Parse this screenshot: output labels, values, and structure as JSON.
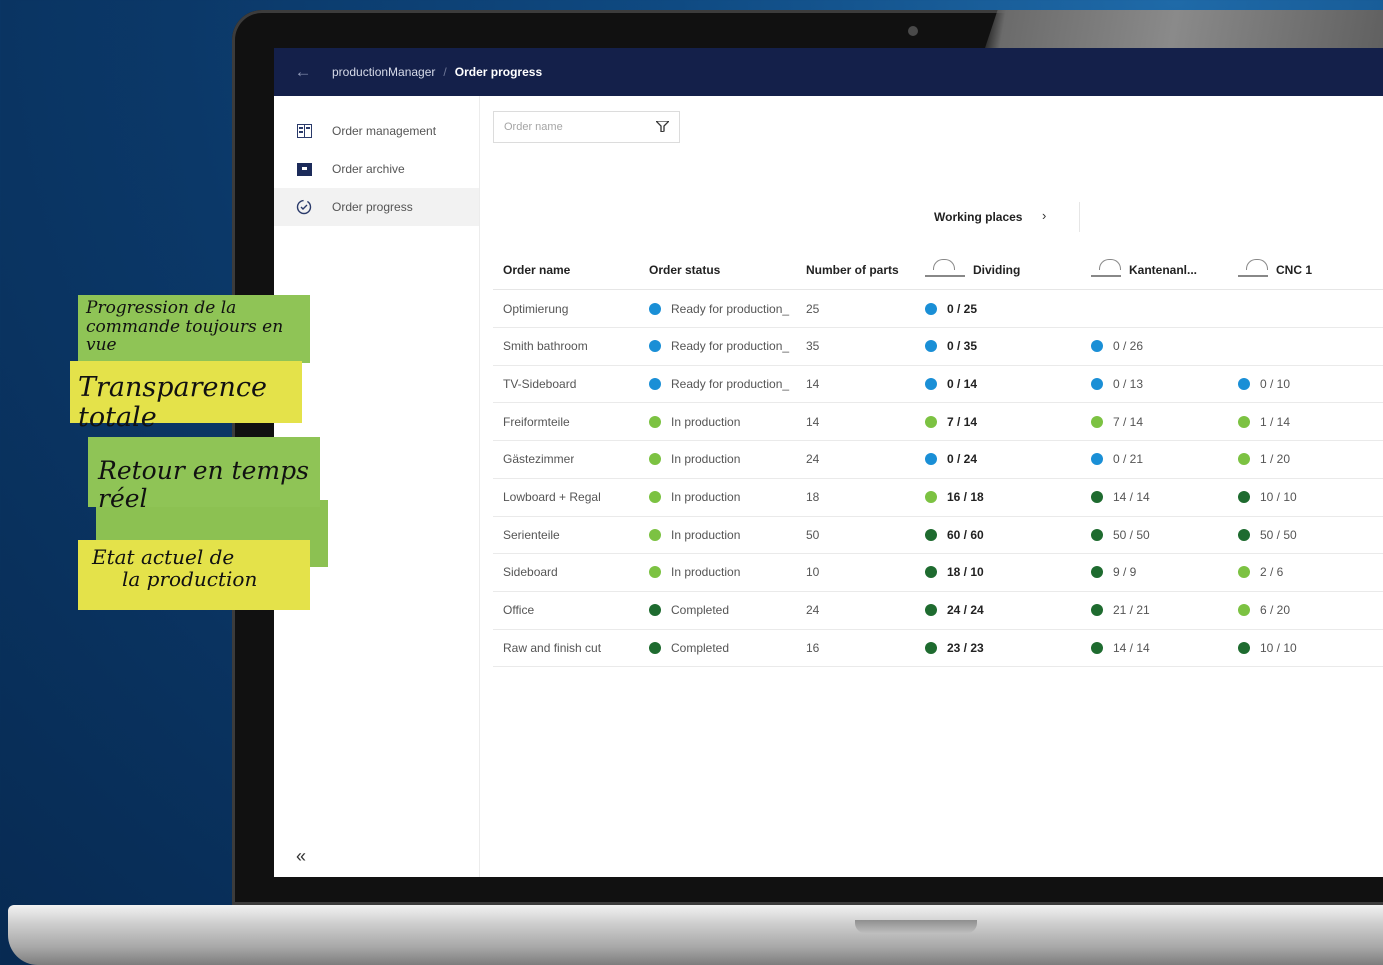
{
  "header": {
    "app": "productionManager",
    "separator": "/",
    "page": "Order progress"
  },
  "sidebar": {
    "items": [
      {
        "label": "Order management",
        "icon": "list-board-icon"
      },
      {
        "label": "Order archive",
        "icon": "archive-box-icon"
      },
      {
        "label": "Order progress",
        "icon": "progress-clock-icon"
      }
    ],
    "collapse_label": "«"
  },
  "filter": {
    "placeholder": "Order name"
  },
  "working_places": {
    "label": "Working places"
  },
  "columns": [
    "Order name",
    "Order status",
    "Number of parts",
    "Dividing",
    "Kantenanl...",
    "CNC 1"
  ],
  "status_colors": {
    "ready": "#1a8fd6",
    "in_production": "#7cc242",
    "completed": "#1e6b2f"
  },
  "rows": [
    {
      "name": "Optimierung",
      "status": "Ready for production_",
      "parts": "25",
      "dividing": "0 / 25",
      "kanten": "",
      "cnc": ""
    },
    {
      "name": "Smith bathroom",
      "status": "Ready for production_",
      "parts": "35",
      "dividing": "0 / 35",
      "kanten": "0 / 26",
      "cnc": ""
    },
    {
      "name": "TV-Sideboard",
      "status": "Ready for production_",
      "parts": "14",
      "dividing": "0 / 14",
      "kanten": "0 / 13",
      "cnc": "0 / 10"
    },
    {
      "name": "Freiformteile",
      "status": "In production",
      "parts": "14",
      "dividing": "7 / 14",
      "kanten": "7 / 14",
      "cnc": "1 / 14"
    },
    {
      "name": "Gästezimmer",
      "status": "In production",
      "parts": "24",
      "dividing": "0 / 24",
      "kanten": "0 / 21",
      "cnc": "1 / 20"
    },
    {
      "name": "Lowboard + Regal",
      "status": "In production",
      "parts": "18",
      "dividing": "16 / 18",
      "kanten": "14 / 14",
      "cnc": "10 / 10"
    },
    {
      "name": "Serienteile",
      "status": "In production",
      "parts": "50",
      "dividing": "60 / 60",
      "kanten": "50 / 50",
      "cnc": "50 / 50"
    },
    {
      "name": "Sideboard",
      "status": "In production",
      "parts": "10",
      "dividing": "18 / 10",
      "kanten": "9 / 9",
      "cnc": "2 / 6"
    },
    {
      "name": "Office",
      "status": "Completed",
      "parts": "24",
      "dividing": "24 / 24",
      "kanten": "21 / 21",
      "cnc": "6 / 20"
    },
    {
      "name": "Raw and finish cut",
      "status": "Completed",
      "parts": "16",
      "dividing": "23 / 23",
      "kanten": "14 / 14",
      "cnc": "10 / 10"
    }
  ],
  "notes": [
    {
      "line1": "Progression de la",
      "line2": "commande toujours en vue"
    },
    {
      "line1": "Transparence totale"
    },
    {
      "line1": "Retour en temps réel"
    },
    {
      "line1": "Etat actuel de",
      "line2": "la production"
    }
  ]
}
